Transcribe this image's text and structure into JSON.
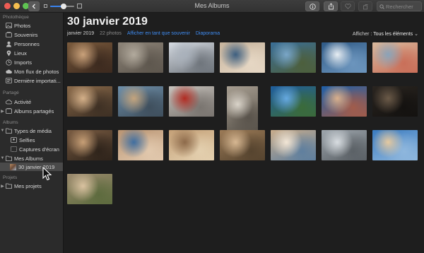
{
  "window": {
    "title": "Mes Albums",
    "search_placeholder": "Rechercher",
    "zoom_level": 0.55
  },
  "sidebar": {
    "sections": [
      {
        "header": "Photothèque",
        "items": [
          {
            "label": "Photos",
            "icon": "photos-icon"
          },
          {
            "label": "Souvenirs",
            "icon": "memories-icon"
          },
          {
            "label": "Personnes",
            "icon": "people-icon"
          },
          {
            "label": "Lieux",
            "icon": "places-pin-icon"
          },
          {
            "label": "Imports",
            "icon": "imports-clock-icon"
          },
          {
            "label": "Mon flux de photos",
            "icon": "photo-stream-icon"
          },
          {
            "label": "Dernière importati...",
            "icon": "last-import-icon"
          }
        ]
      },
      {
        "header": "Partagé",
        "items": [
          {
            "label": "Activité",
            "icon": "activity-cloud-icon"
          },
          {
            "label": "Albums partagés",
            "icon": "shared-album-icon"
          }
        ]
      },
      {
        "header": "Albums",
        "items": [
          {
            "label": "Types de média",
            "icon": "folder-icon"
          },
          {
            "label": "Selfies",
            "icon": "selfie-icon"
          },
          {
            "label": "Captures d'écran",
            "icon": "screenshot-icon"
          },
          {
            "label": "Mes Albums",
            "icon": "folder-icon"
          },
          {
            "label": "30 janvier 2019",
            "icon": "album-thumbnail"
          }
        ]
      },
      {
        "header": "Projets",
        "items": [
          {
            "label": "Mes projets",
            "icon": "folder-icon"
          }
        ]
      }
    ]
  },
  "main": {
    "title": "30 janvier 2019",
    "date_label": "janvier 2019",
    "photo_count": "22 photos",
    "link_memory": "Afficher en tant que souvenir",
    "link_slideshow": "Diaporama",
    "filter_label": "Afficher :",
    "filter_value": "Tous les éléments",
    "thumbnails": [
      {
        "subject": "couple selfie",
        "colors": [
          "#7a5a3c",
          "#c9a17a",
          "#3c2a1f"
        ]
      },
      {
        "subject": "stone relief",
        "colors": [
          "#8d8478",
          "#b2aa9d",
          "#5e574e"
        ]
      },
      {
        "subject": "cathedral with birds",
        "colors": [
          "#d6dbe2",
          "#a9b1bb",
          "#6f757c"
        ]
      },
      {
        "subject": "woman selfie in square",
        "colors": [
          "#c6b39c",
          "#3d5f80",
          "#e6d7c4"
        ]
      },
      {
        "subject": "lake and mountains",
        "colors": [
          "#3a6e96",
          "#7aa6c7",
          "#4d5f3c"
        ]
      },
      {
        "subject": "waves on rocks",
        "colors": [
          "#2f5a86",
          "#e8eef3",
          "#6c95bd"
        ]
      },
      {
        "subject": "hands with cones",
        "colors": [
          "#d9b99d",
          "#8aa3b9",
          "#c96f59"
        ]
      },
      {
        "subject": "friends selfie",
        "colors": [
          "#8a6a4a",
          "#d4b089",
          "#3e3024"
        ]
      },
      {
        "subject": "gondola canal",
        "colors": [
          "#6e8fa9",
          "#c4a47d",
          "#3f4f5d"
        ]
      },
      {
        "subject": "red car",
        "colors": [
          "#c7c2bc",
          "#b12b22",
          "#7a7570"
        ]
      },
      {
        "subject": "statue",
        "colors": [
          "#a69d90",
          "#d9d3c9",
          "#59534b"
        ]
      },
      {
        "subject": "coastline",
        "colors": [
          "#1f5d9c",
          "#66a9e0",
          "#3b6b3a"
        ]
      },
      {
        "subject": "harbour houses",
        "colors": [
          "#1e5fa8",
          "#d9b08c",
          "#a15c4b"
        ]
      },
      {
        "subject": "spiral staircase",
        "colors": [
          "#2a2520",
          "#6b5a48",
          "#141210"
        ]
      },
      {
        "subject": "group selfie",
        "colors": [
          "#7b5d43",
          "#c79f76",
          "#2f241b"
        ]
      },
      {
        "subject": "family selfie",
        "colors": [
          "#b99472",
          "#3f6ea0",
          "#e1c8ad"
        ]
      },
      {
        "subject": "painted ceiling",
        "colors": [
          "#c4a077",
          "#8d6a4a",
          "#e3cfae"
        ]
      },
      {
        "subject": "crowd square",
        "colors": [
          "#9c7b57",
          "#d6b792",
          "#56442f"
        ]
      },
      {
        "subject": "cafe table",
        "colors": [
          "#c9ad8c",
          "#f2e6d6",
          "#5f7f9e"
        ]
      },
      {
        "subject": "gargoyle",
        "colors": [
          "#9ea6ad",
          "#d8dde1",
          "#5b6166"
        ]
      },
      {
        "subject": "beach selfie",
        "colors": [
          "#3a7bc0",
          "#e5c9a0",
          "#8fb7dd"
        ]
      },
      {
        "subject": "selfie with flowers",
        "colors": [
          "#9c8a6e",
          "#d9c2a0",
          "#5d6b3e"
        ]
      }
    ]
  }
}
